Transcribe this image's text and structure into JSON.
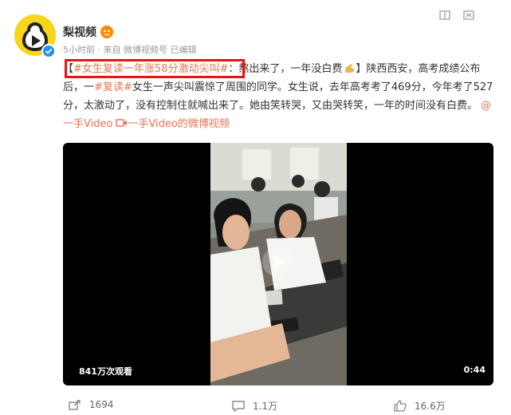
{
  "author": {
    "name": "梨视频",
    "meta": "5小时前 · 来自 微博视频号 已编辑"
  },
  "post": {
    "bracket_open": "【",
    "title_tag": "#女生复读一年涨58分激动尖叫#",
    "text_1": "：熬出来了，一年没白费",
    "text_2": "】陕西西安，高考成绩公布后，一",
    "tag_2": "#复读#",
    "text_3": "女生一声尖叫震惊了周围的同学。女生说，去年高考考了469分，今年考了527分，太激动了，没有控制住就喊出来了。她由笑转哭，又由哭转笑，一年的时间没有白费。",
    "mention": "@一手Video",
    "video_link": "一手Video的微博视频"
  },
  "video": {
    "views": "841万次观看",
    "duration": "0:44"
  },
  "actions": {
    "share_count": "1694",
    "comment_count": "1.1万",
    "like_count": "16.6万"
  },
  "colors": {
    "link": "#eb7350",
    "highlight": "#ee1111",
    "avatar": "#f7d61c"
  }
}
